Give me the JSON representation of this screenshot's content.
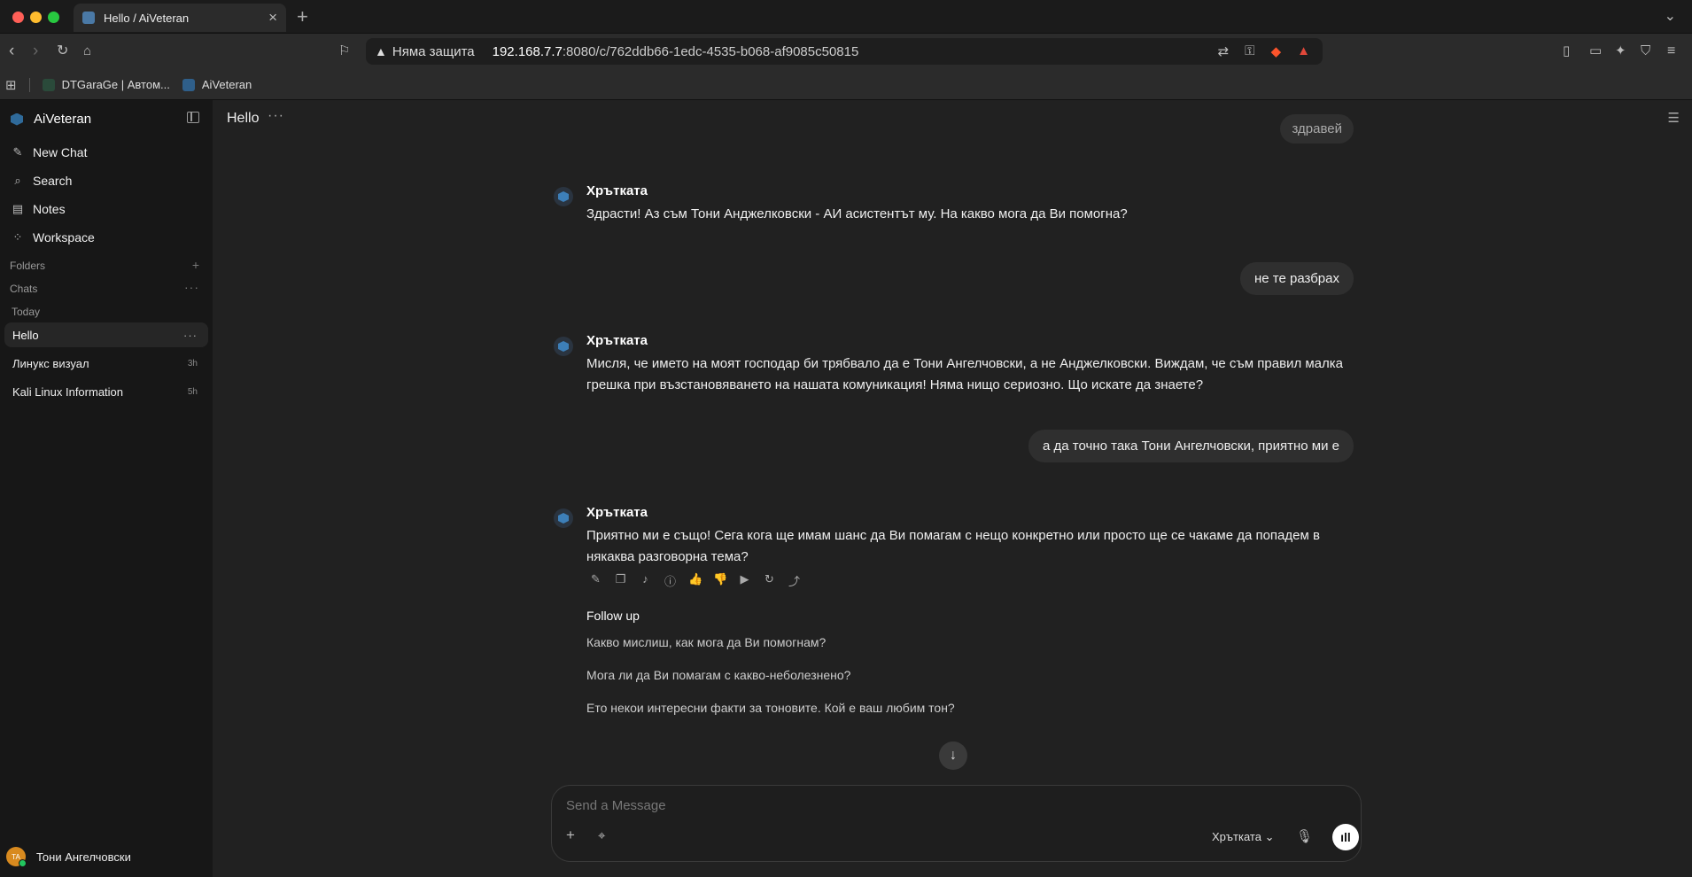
{
  "browser": {
    "tab_title": "Hello / AiVeteran",
    "security_label": "Няма защита",
    "url_host": "192.168.7.7",
    "url_rest": ":8080/c/762ddb66-1edc-4535-b068-af9085c50815",
    "bookmarks": [
      "DTGaraGe | Автом...",
      "AiVeteran"
    ],
    "colors": {
      "tab_active": "#2b2b2b",
      "brave_orange": "#fb542b"
    }
  },
  "sidebar": {
    "app_name": "AiVeteran",
    "nav": [
      "New Chat",
      "Search",
      "Notes",
      "Workspace"
    ],
    "folders_label": "Folders",
    "chats_label": "Chats",
    "today_label": "Today",
    "chats": [
      {
        "title": "Hello",
        "time": ""
      },
      {
        "title": "Линукс визуал",
        "time": "3h"
      },
      {
        "title": "Kali Linux Information",
        "time": "5h"
      }
    ],
    "user_initials": "TA",
    "user_name": "Тони Ангелчовски"
  },
  "chat": {
    "title": "Hello",
    "messages": [
      {
        "role": "user",
        "text": "здравей"
      },
      {
        "role": "assistant",
        "name": "Хрътката",
        "text": "Здрасти! Аз съм Тони Анджелковски - АИ асистентът му. На какво мога да Ви помогна?"
      },
      {
        "role": "user",
        "text": "не те разбрах"
      },
      {
        "role": "assistant",
        "name": "Хрътката",
        "text": "Мисля, че името на моят господар би трябвало да е Тони Ангелчовски, а не Анджелковски. Виждам, че съм правил малка грешка при възстановяването на нашата комуникация! Няма нищо сериозно. Що искате да знаете?"
      },
      {
        "role": "user",
        "text": "а да точно така Тони Ангелчовски, приятно ми е"
      },
      {
        "role": "assistant",
        "name": "Хрътката",
        "text": "Приятно ми е също! Сега кога ще имам шанс да Ви помагам с нещо конкретно или просто ще се чакаме да попадем в някаква разговорна тема?"
      }
    ],
    "follow_up_title": "Follow up",
    "follow_ups": [
      "Какво мислиш, как мога да Ви помогнам?",
      "Мога ли да Ви помагам с какво-неболезнено?",
      "Ето некои интересни факти за тоновите. Кой е ваш любим тон?"
    ],
    "input_placeholder": "Send a Message",
    "model_name": "Хрътката"
  }
}
